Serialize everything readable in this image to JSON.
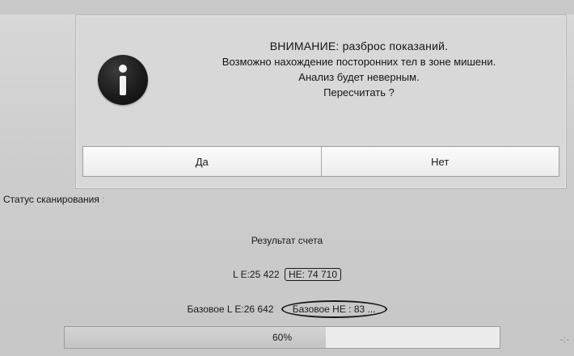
{
  "dialog": {
    "message_lines": [
      "ВНИМАНИЕ:  разброс показаний.",
      "Возможно нахождение посторонних тел в зоне мишени.",
      "Анализ будет неверным.",
      "Пересчитать ?"
    ],
    "icon": "info-icon",
    "yes_label": "Да",
    "no_label": "Нет"
  },
  "status": {
    "label": "Статус сканирования",
    "separator": ":"
  },
  "result": {
    "title": "Результат счета",
    "le": "L E:25 422",
    "he": "HE: 74 710",
    "base_le": "Базовое L E:26 642",
    "base_he": "Базовое HE : 83 ..."
  },
  "progress": {
    "value": 0.6,
    "label": "60%"
  },
  "side_marker": "-:-"
}
